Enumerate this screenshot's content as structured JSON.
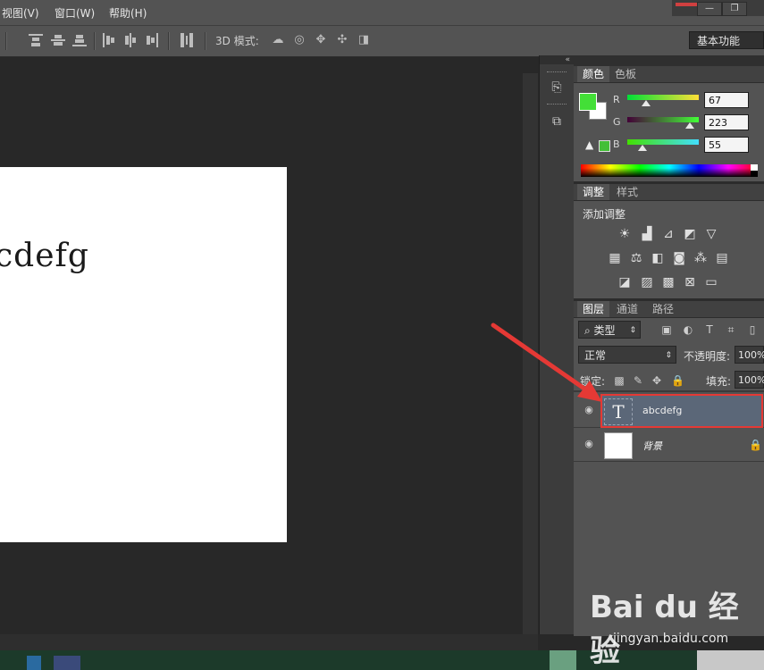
{
  "menu": {
    "items": [
      "视图(V)",
      "窗口(W)",
      "帮助(H)"
    ]
  },
  "options_bar": {
    "mode_3d_label": "3D 模式:",
    "workspace": "基本功能"
  },
  "document": {
    "text": "abcdefg",
    "visible_text": "cdefg"
  },
  "color_panel": {
    "tabs": [
      "颜色",
      "色板"
    ],
    "foreground": "#43df37",
    "background": "#ffffff",
    "channels": [
      {
        "label": "R",
        "value": "67"
      },
      {
        "label": "G",
        "value": "223"
      },
      {
        "label": "B",
        "value": "55"
      }
    ]
  },
  "adjustments_panel": {
    "tabs": [
      "调整",
      "样式"
    ],
    "title": "添加调整"
  },
  "layers_panel": {
    "tabs": [
      "图层",
      "通道",
      "路径"
    ],
    "filter_kind": "类型",
    "blend_mode": "正常",
    "opacity_label": "不透明度:",
    "opacity_value": "100%",
    "lock_label": "锁定:",
    "fill_label": "填充:",
    "fill_value": "100%",
    "layers": [
      {
        "name": "abcdefg",
        "type": "text",
        "thumb_glyph": "T",
        "selected": true
      },
      {
        "name": "背景",
        "type": "background",
        "locked": true,
        "selected": false
      }
    ]
  },
  "watermark": {
    "logo": "Bai du 经验",
    "url": "jingyan.baidu.com"
  },
  "colors": {
    "accent_selection": "#e53935",
    "selected_layer_bg": "#5b6778"
  }
}
